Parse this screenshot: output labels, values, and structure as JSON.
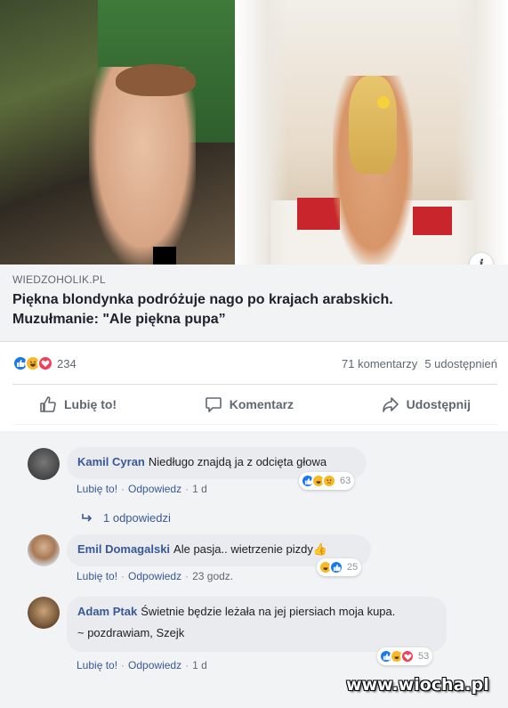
{
  "post": {
    "link_domain": "WIEDZOHOLIK.PL",
    "link_title_line1": "Piękna blondynka podróżuje nago po krajach arabskich.",
    "link_title_line2": "Muzułmanie: \"Ale piękna pupa”",
    "info_icon": "i"
  },
  "stats": {
    "reaction_icons": [
      "like-icon",
      "haha-icon",
      "love-icon"
    ],
    "reaction_count": "234",
    "comments": "71 komentarzy",
    "shares": "5 udostępnień"
  },
  "actions": {
    "like_label": "Lubię to!",
    "comment_label": "Komentarz",
    "share_label": "Udostępnij"
  },
  "comments": [
    {
      "author": "Kamil Cyran",
      "text": "Niedługo znajdą ja z odcięta głowa",
      "like": "Lubię to!",
      "reply": "Odpowiedz",
      "time": "1 d",
      "reactions": [
        "like-icon",
        "haha-icon",
        "sad-icon"
      ],
      "reaction_count": "63"
    },
    {
      "author": "Emil Domagalski",
      "text": "Ale pasja.. wietrzenie pizdy👍",
      "like": "Lubię to!",
      "reply": "Odpowiedz",
      "time": "23 godz.",
      "reactions": [
        "haha-icon",
        "like-icon"
      ],
      "reaction_count": "25"
    },
    {
      "author": "Adam Ptak",
      "text": "Świetnie będzie leżała na jej piersiach moja kupa.",
      "text2": "~ pozdrawiam, Szejk",
      "like": "Lubię to!",
      "reply": "Odpowiedz",
      "time": "1 d",
      "reactions": [
        "like-icon",
        "haha-icon",
        "love-icon"
      ],
      "reaction_count": "53"
    }
  ],
  "replies_link": "1 odpowiedzi",
  "watermark": "www.wiocha.pl",
  "colors": {
    "like": "#1877f2",
    "haha": "#f7b928",
    "love": "#f33e58",
    "link_blue": "#385898",
    "grey_text": "#606770"
  }
}
